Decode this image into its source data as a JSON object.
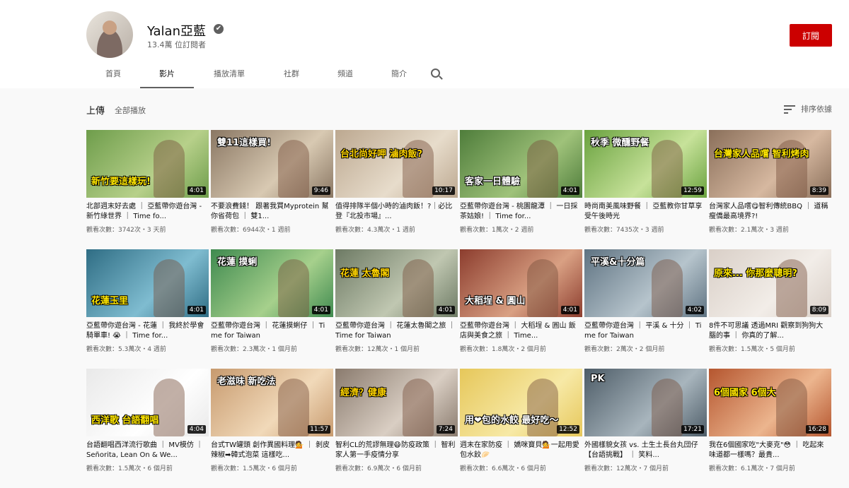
{
  "channel": {
    "name": "Yalan亞藍",
    "verified_glyph": "✔",
    "subscribers": "13.4萬 位訂閱者",
    "subscribe_label": "訂閱"
  },
  "tabs": [
    {
      "label": "首頁",
      "w": 76,
      "active": false
    },
    {
      "label": "影片",
      "w": 76,
      "active": true
    },
    {
      "label": "播放清單",
      "w": 100,
      "active": false
    },
    {
      "label": "社群",
      "w": 76,
      "active": false
    },
    {
      "label": "頻道",
      "w": 76,
      "active": false
    },
    {
      "label": "簡介",
      "w": 76,
      "active": false
    }
  ],
  "section": {
    "title": "上傳",
    "play_all": "全部播放",
    "sort_label": "排序依據"
  },
  "icons": {
    "search": "search-icon",
    "sort": "sort-icon",
    "verified": "verified-icon"
  },
  "videos": [
    {
      "duration": "4:01",
      "title": "北部週末好去處 ｜ 亞藍帶你遊台灣 - 新竹綠世界 ｜ Time fo...",
      "meta": "觀看次數：3742次・3 天前",
      "caption": "新竹要這樣玩!",
      "bg": "#6e9d4b",
      "bg2": "#b7d08a"
    },
    {
      "duration": "9:46",
      "title": "不要浪費錢！ 跟著我買Myprotein 幫你省荷包 ｜ 雙1...",
      "meta": "觀看次數：6944次・1 週前",
      "caption": "雙11這樣買!",
      "bg": "#8a7763",
      "bg2": "#d8c9b2"
    },
    {
      "duration": "10:17",
      "title": "值得排隊半個小時的滷肉飯！?｜必比登『北投市場』...",
      "meta": "觀看次數：4.3萬次・1 週前",
      "caption": "台北尚好呷 滷肉飯?",
      "bg": "#bca890",
      "bg2": "#e7dccb"
    },
    {
      "duration": "4:01",
      "title": "亞藍帶你遊台灣 - 桃園龍潭 ｜ 一日採茶姑娘! ｜ Time for...",
      "meta": "觀看次數：1萬次・2 週前",
      "caption": "客家一日體驗",
      "bg": "#4f7d3b",
      "bg2": "#9fc27a"
    },
    {
      "duration": "12:59",
      "title": "時尚南美風味野餐 ｜ 亞藍教你甘草享受午後時光",
      "meta": "觀看次數：7435次・3 週前",
      "caption": "秋季 微醺野餐",
      "bg": "#6aa23f",
      "bg2": "#c7e29a"
    },
    {
      "duration": "8:39",
      "title": "台灣家人品嚐😋智利傳統BBQ ｜ 道稱瘦僑最高境界?!",
      "meta": "觀看次數：2.1萬次・3 週前",
      "caption": "台灣家人品嚐 智利烤肉",
      "bg": "#8a6f5a",
      "bg2": "#d6b8a0"
    },
    {
      "duration": "4:01",
      "title": "亞藍帶你遊台灣 - 花蓮 ｜ 我終於學會騎單車! 😭 ｜ Time for...",
      "meta": "觀看次數：5.3萬次・4 週前",
      "caption": "花蓮玉里",
      "bg": "#2f6d84",
      "bg2": "#7fbcd0"
    },
    {
      "duration": "4:01",
      "title": "亞藍帶你遊台灣 ｜ 花蓮摸蜊仔 ｜ Time for Taiwan",
      "meta": "觀看次數：2.3萬次・1 個月前",
      "caption": "花蓮 摸蜊",
      "bg": "#3f8a4f",
      "bg2": "#a6d08c"
    },
    {
      "duration": "4:01",
      "title": "亞藍帶你遊台灣 ｜ 花蓮太魯閣之旅 ｜ Time for Taiwan",
      "meta": "觀看次數：12萬次・1 個月前",
      "caption": "花蓮 太魯閣",
      "bg": "#6d7a64",
      "bg2": "#c0c7b1"
    },
    {
      "duration": "4:01",
      "title": "亞藍帶你遊台灣 ｜ 大稻埕 & 圓山 飯店與美食之旅 ｜ Time...",
      "meta": "觀看次數：1.8萬次・2 個月前",
      "caption": "大稻埕 & 圓山",
      "bg": "#8c3d2e",
      "bg2": "#d9a083"
    },
    {
      "duration": "4:02",
      "title": "亞藍帶你遊台灣 ｜ 平溪 & 十分 ｜ Time for Taiwan",
      "meta": "觀看次數：2萬次・2 個月前",
      "caption": "平溪&十分篇",
      "bg": "#5f7382",
      "bg2": "#b6c4cc"
    },
    {
      "duration": "8:09",
      "title": "8件不可思議 透過MRI 觀察到狗狗大腦的事 ｜ 你真的了解...",
      "meta": "觀看次數：1.5萬次・5 個月前",
      "caption": "原來... 你那麼聰明?",
      "bg": "#d9cfc7",
      "bg2": "#f2ede8"
    },
    {
      "duration": "4:04",
      "title": "台語翻唱西洋流行歌曲 ｜ MV模仿 ｜ Señorita, Lean On & We...",
      "meta": "觀看次數：1.5萬次・6 個月前",
      "caption": "西洋歌 台語翻唱",
      "bg": "#e9e9e9",
      "bg2": "#ffffff"
    },
    {
      "duration": "11:57",
      "title": "台式TW罐頭 創作異國料理💁 ｜ 剝皮辣椒➡韓式泡菜 這樣吃...",
      "meta": "觀看次數：1.5萬次・6 個月前",
      "caption": "老滋味 新吃法",
      "bg": "#c79a6e",
      "bg2": "#f1d9b9"
    },
    {
      "duration": "7:24",
      "title": "智利CL的荒謬無理😷防疫政策 ｜ 智利家人第一手疫情分享",
      "meta": "觀看次數：6.9萬次・6 個月前",
      "caption": "經濟？健康",
      "bg": "#8a7b6e",
      "bg2": "#d9cec3"
    },
    {
      "duration": "12:52",
      "title": "週末在家防疫 ｜ 嬌咪寶貝💁一起用愛包水餃🥟",
      "meta": "觀看次數：6.6萬次・6 個月前",
      "caption": "用❤包的水餃 最好吃～",
      "bg": "#e6c75a",
      "bg2": "#f7e9a6"
    },
    {
      "duration": "17:21",
      "title": "外國樣貌女孩 vs. 土生土長台丸団仔【台語挑戰】 ｜ 笑料...",
      "meta": "觀看次數：12萬次・7 個月前",
      "caption": "PK",
      "bg": "#4d5c67",
      "bg2": "#a8b5bd"
    },
    {
      "duration": "16:28",
      "title": "我在6個國家吃\"大麥克\"😳 ｜ 吃起來味道都一樣嗎？最貴...",
      "meta": "觀看次數：6.1萬次・7 個月前",
      "caption": "6個國家 6個大",
      "bg": "#b5562f",
      "bg2": "#ecb58e"
    }
  ]
}
